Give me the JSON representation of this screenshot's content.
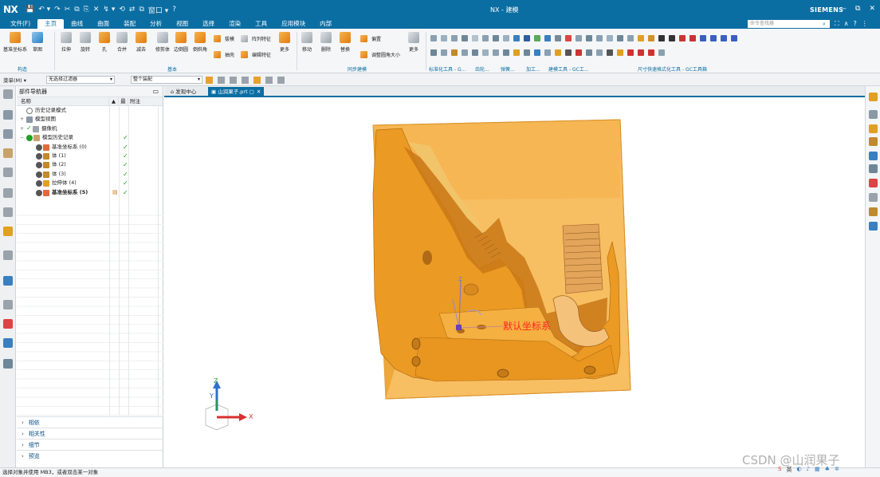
{
  "titlebar": {
    "logo": "NX",
    "title": "NX - 建模",
    "brand": "SIEMENS",
    "quick_access": [
      "💾",
      "↶ ▾",
      "↷",
      "✂",
      "⧉",
      "⎘",
      "✕",
      "↯ ▾",
      "⟲",
      "⇄",
      "⧉",
      "窗口 ▾",
      "?"
    ],
    "window_controls": [
      "‒",
      "⧉",
      "✕"
    ]
  },
  "menubar": {
    "items": [
      "文件(F)",
      "主页",
      "曲线",
      "曲面",
      "装配",
      "分析",
      "视图",
      "选择",
      "渲染",
      "工具",
      "应用模块",
      "内部"
    ],
    "active_index": 1,
    "search_placeholder": "命令查找器",
    "right_icons": [
      "⛶",
      "∧",
      "?",
      "⋮"
    ]
  },
  "ribbon": {
    "buttons": [
      {
        "label": "基准坐标系"
      },
      {
        "label": "草图"
      },
      {
        "label": "拉伸"
      },
      {
        "label": "旋转"
      },
      {
        "label": "孔"
      },
      {
        "label": "合并"
      },
      {
        "label": "减去"
      },
      {
        "label": "修剪体"
      },
      {
        "label": "边倒圆"
      },
      {
        "label": "倒斜角"
      },
      {
        "label": "拔模"
      },
      {
        "label": "阵列特征"
      },
      {
        "label": "抽壳"
      },
      {
        "label": "编辑特征"
      },
      {
        "label": "更多"
      },
      {
        "label": "移动"
      },
      {
        "label": "删除"
      },
      {
        "label": "替换"
      },
      {
        "label": "偏置"
      },
      {
        "label": "调整圆角大小"
      },
      {
        "label": "更多"
      }
    ],
    "groups": [
      "构造",
      "基本",
      "同步建模",
      "标准化工具 - G...",
      "齿轮...",
      "弹簧...",
      "加工...",
      "建模工具 - GC工...",
      "尺寸快速格式化工具 - GC工具箱"
    ]
  },
  "selbar": {
    "menu": "菜单(M) ▾",
    "filter": "无选择过滤器",
    "scope": "整个装配"
  },
  "navigator": {
    "title": "部件导航器",
    "columns": [
      "名称",
      "▲",
      "最",
      "附注"
    ],
    "rows": [
      {
        "label": "历史记录模式"
      },
      {
        "label": "模型视图"
      },
      {
        "label": "摄像机"
      },
      {
        "label": "模型历史记录"
      },
      {
        "label": "基准坐标系 (0)"
      },
      {
        "label": "体 (1)"
      },
      {
        "label": "体 (2)"
      },
      {
        "label": "体 (3)"
      },
      {
        "label": "拉伸体 (4)"
      },
      {
        "label": "基准坐标系 (5)"
      }
    ],
    "panels": [
      "相依",
      "相关性",
      "细节",
      "预览"
    ]
  },
  "tabs": {
    "home": "发现中心",
    "active": "山润果子.prt"
  },
  "viewport": {
    "csys_label": "默认坐标系",
    "axis_x": "X",
    "axis_y": "Y",
    "axis_z": "Z",
    "colors": {
      "body": "#f0a32a",
      "body_dark": "#c9771a",
      "transparent_box": "#f6b040"
    }
  },
  "status": {
    "text": "选择对象并使用 MB3，或者双击某一对象",
    "watermark": "CSDN @山润果子"
  }
}
